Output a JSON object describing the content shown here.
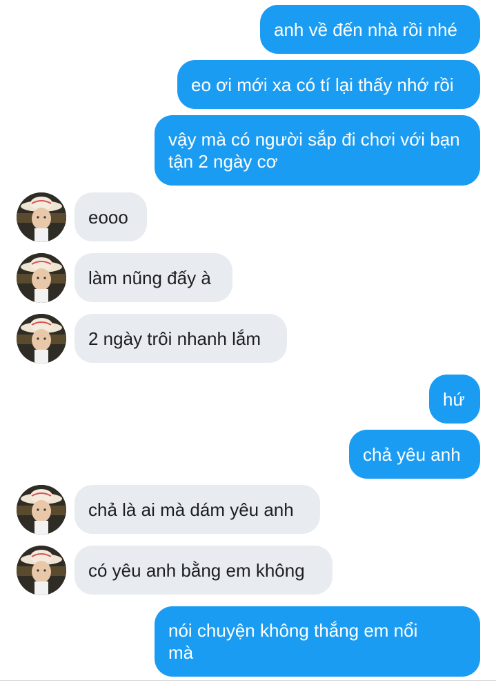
{
  "conversation": {
    "messages": [
      {
        "sender": "me",
        "text": "anh về đến nhà rồi nhé"
      },
      {
        "sender": "me",
        "text": "eo ơi mới xa có tí lại thấy nhớ rồi"
      },
      {
        "sender": "me",
        "text": "vậy mà có người sắp đi chơi với bạn tận 2 ngày cơ"
      },
      {
        "sender": "them",
        "text": "eooo"
      },
      {
        "sender": "them",
        "text": "làm nũng đấy à"
      },
      {
        "sender": "them",
        "text": "2 ngày trôi nhanh lắm"
      },
      {
        "sender": "me",
        "text": "hứ"
      },
      {
        "sender": "me",
        "text": "chả yêu anh"
      },
      {
        "sender": "them",
        "text": "chả là ai mà dám yêu anh"
      },
      {
        "sender": "them",
        "text": "có yêu anh bằng em không"
      },
      {
        "sender": "me",
        "text": "nói chuyện không thắng em nổi mà"
      }
    ]
  },
  "colors": {
    "outgoing_bubble": "#1a9cf2",
    "incoming_bubble": "#e8ebef",
    "outgoing_text": "#ffffff",
    "incoming_text": "#1c1e21"
  },
  "icons": {
    "avatar": "profile-photo-avatar"
  }
}
